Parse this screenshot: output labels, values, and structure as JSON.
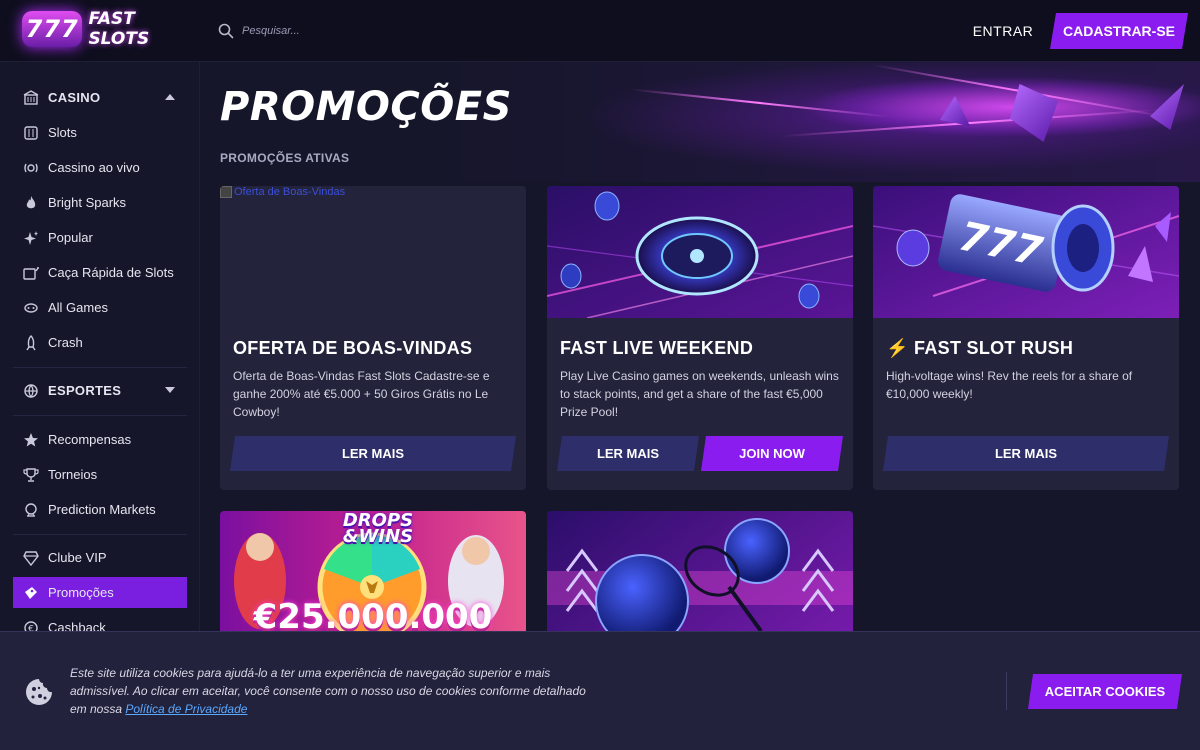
{
  "brand": {
    "badge": "777",
    "name": "FAST SLOTS"
  },
  "header": {
    "search_placeholder": "Pesquisar...",
    "login_label": "ENTRAR",
    "signup_label": "CADASTRAR-SE"
  },
  "sidebar": {
    "casino": {
      "label": "CASINO",
      "items": [
        {
          "label": "Slots",
          "icon": "slots-icon"
        },
        {
          "label": "Cassino ao vivo",
          "icon": "live-casino-icon"
        },
        {
          "label": "Bright Sparks",
          "icon": "flame-icon"
        },
        {
          "label": "Popular",
          "icon": "sparkle-icon"
        },
        {
          "label": "Caça Rápida de Slots",
          "icon": "slot-hunt-icon"
        },
        {
          "label": "All Games",
          "icon": "games-icon"
        },
        {
          "label": "Crash",
          "icon": "rocket-icon"
        }
      ]
    },
    "sports": {
      "label": "ESPORTES"
    },
    "extras": [
      {
        "label": "Recompensas",
        "icon": "star-icon"
      },
      {
        "label": "Torneios",
        "icon": "trophy-icon"
      },
      {
        "label": "Prediction Markets",
        "icon": "prediction-icon"
      }
    ],
    "vip": [
      {
        "label": "Clube VIP",
        "icon": "diamond-icon"
      },
      {
        "label": "Promoções",
        "icon": "promo-icon",
        "active": true
      },
      {
        "label": "Cashback",
        "icon": "cashback-icon"
      }
    ]
  },
  "main": {
    "title": "PROMOÇÕES",
    "section_label": "PROMOÇÕES ATIVAS",
    "cards": [
      {
        "image_alt": "Oferta de Boas-Vindas",
        "title": "OFERTA DE BOAS-VINDAS",
        "description": "Oferta de Boas-Vindas Fast Slots Cadastre-se e ganhe 200% até €5.000 + 50 Giros Grátis no Le Cowboy!",
        "more_label": "LER MAIS"
      },
      {
        "title": "FAST LIVE WEEKEND",
        "description": "Play Live Casino games on weekends, unleash wins to stack points, and get a share of the fast €5,000 Prize Pool!",
        "more_label": "LER MAIS",
        "join_label": "JOIN NOW"
      },
      {
        "title_icon": "⚡",
        "title": "FAST SLOT RUSH",
        "description": "High-voltage wins! Rev the reels for a share of €10,000 weekly!",
        "more_label": "LER MAIS"
      },
      {
        "banner_heading": "DROPS\n&WINS",
        "banner_amount": "€25.000.000"
      },
      {}
    ]
  },
  "cookie": {
    "text": "Este site utiliza cookies para ajudá-lo a ter uma experiência de navegação superior e mais admissível. Ao clicar em aceitar, você consente com o nosso uso de cookies conforme detalhado em nossa",
    "link_label": "Política de Privacidade",
    "accept_label": "ACEITAR COOKIES"
  },
  "colors": {
    "accent": "#8b1cf0",
    "bg": "#16162b",
    "card": "#23233b",
    "button_secondary": "#2e2e6b"
  }
}
